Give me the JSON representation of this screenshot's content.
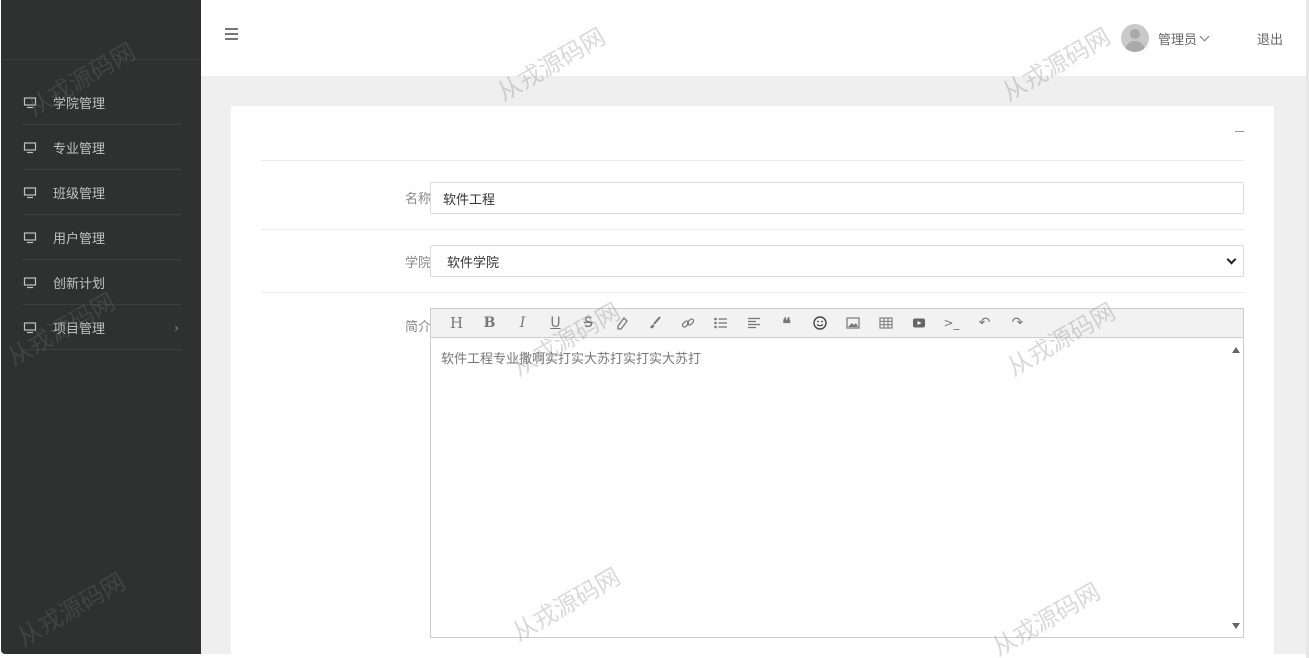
{
  "sidebar": {
    "items": [
      {
        "label": "学院管理",
        "icon": "monitor-icon"
      },
      {
        "label": "专业管理",
        "icon": "monitor-icon"
      },
      {
        "label": "班级管理",
        "icon": "monitor-icon"
      },
      {
        "label": "用户管理",
        "icon": "monitor-icon"
      },
      {
        "label": "创新计划",
        "icon": "monitor-icon"
      },
      {
        "label": "项目管理",
        "icon": "monitor-icon",
        "has_submenu": true
      }
    ]
  },
  "header": {
    "menu_icon": "hamburger-icon",
    "user_name": "管理员",
    "logout_label": "退出"
  },
  "form": {
    "name_label": "名称",
    "name_value": "软件工程",
    "college_label": "学院",
    "college_value": "软件学院",
    "intro_label": "简介",
    "intro_value": "软件工程专业撒啊实打实大苏打实打实大苏打",
    "toolbar_icons": [
      "heading-icon",
      "bold-icon",
      "italic-icon",
      "underline-icon",
      "strikethrough-icon",
      "eraser-icon",
      "brush-icon",
      "link-icon",
      "list-icon",
      "align-icon",
      "quote-icon",
      "emoji-icon",
      "image-icon",
      "table-icon",
      "video-icon",
      "code-icon",
      "undo-icon",
      "redo-icon"
    ]
  },
  "watermark": "从戎源码网",
  "colors": {
    "sidebar_bg": "#2f3030",
    "content_bg": "#efefef"
  }
}
